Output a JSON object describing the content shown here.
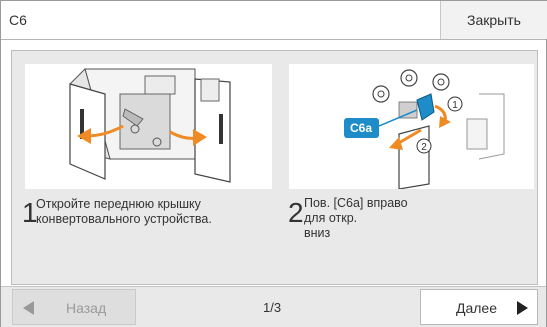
{
  "header": {
    "title": "C6",
    "close_label": "Закрыть"
  },
  "steps": [
    {
      "number": "1",
      "lines": [
        "Откройте переднюю крышку",
        "конвертовального устройства."
      ]
    },
    {
      "number": "2",
      "lines": [
        "Пов. [C6a] вправо",
        "для откр.",
        "вниз"
      ],
      "callout": "C6a",
      "marker_1": "1",
      "marker_2": "2"
    }
  ],
  "footer": {
    "back_label": "Назад",
    "page_indicator": "1/3",
    "next_label": "Далее"
  },
  "colors": {
    "callout_blue": "#1e8cc8",
    "arrow_orange": "#f08a24"
  }
}
